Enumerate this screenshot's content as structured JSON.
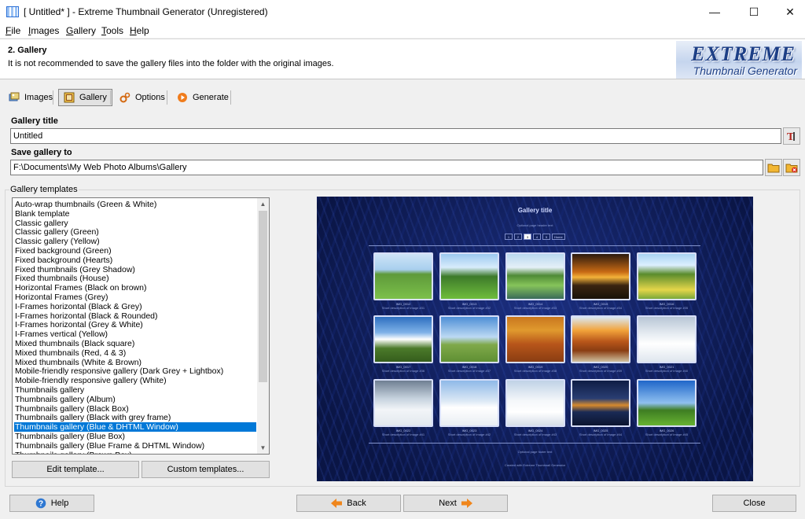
{
  "window": {
    "title": "[ Untitled* ] - Extreme Thumbnail Generator (Unregistered)",
    "controls": {
      "minimize": "—",
      "maximize": "☐",
      "close": "✕"
    }
  },
  "menu": [
    {
      "underline": "F",
      "rest": "ile"
    },
    {
      "underline": "I",
      "rest": "mages"
    },
    {
      "underline": "G",
      "rest": "allery"
    },
    {
      "underline": "T",
      "rest": "ools"
    },
    {
      "underline": "H",
      "rest": "elp"
    }
  ],
  "banner": {
    "title": "2. Gallery",
    "description": "It is not recommended to save the gallery files into the folder with the original images.",
    "logo_line1": "EXTREME",
    "logo_line2": "Thumbnail Generator"
  },
  "tabs": [
    {
      "label": "Images",
      "icon": "images-icon"
    },
    {
      "label": "Gallery",
      "icon": "gallery-icon",
      "active": true
    },
    {
      "label": "Options",
      "icon": "options-gear-icon"
    },
    {
      "label": "Generate",
      "icon": "generate-play-icon"
    }
  ],
  "form": {
    "gallery_title_label": "Gallery title",
    "gallery_title_value": "Untitled",
    "save_to_label": "Save gallery to",
    "save_to_value": "F:\\Documents\\My Web Photo Albums\\Gallery"
  },
  "templates": {
    "group_label": "Gallery templates",
    "items": [
      "Auto-wrap thumbnails (Green & White)",
      "Blank template",
      "Classic gallery",
      "Classic gallery (Green)",
      "Classic gallery (Yellow)",
      "Fixed background (Green)",
      "Fixed background (Hearts)",
      "Fixed thumbnails (Grey Shadow)",
      "Fixed thumbnails (House)",
      "Horizontal Frames (Black on brown)",
      "Horizontal Frames (Grey)",
      "I-Frames horizontal (Black & Grey)",
      "I-Frames horizontal (Black & Rounded)",
      "I-Frames horizontal (Grey & White)",
      "I-Frames vertical (Yellow)",
      "Mixed thumbnails (Black square)",
      "Mixed thumbnails (Red, 4 & 3)",
      "Mixed thumbnails (White & Brown)",
      "Mobile-friendly responsive gallery (Dark Grey + Lightbox)",
      "Mobile-friendly responsive gallery (White)",
      "Thumbnails gallery",
      "Thumbnails gallery (Album)",
      "Thumbnails gallery (Black Box)",
      "Thumbnails gallery (Black with grey frame)",
      "Thumbnails gallery (Blue & DHTML Window)",
      "Thumbnails gallery (Blue Box)",
      "Thumbnails gallery (Blue Frame & DHTML Window)",
      "Thumbnails gallery (Brown Box)"
    ],
    "selected_index": 24,
    "edit_button": "Edit template...",
    "custom_button": "Custom templates..."
  },
  "preview": {
    "title": "Gallery title",
    "header_text": "Optional page header text",
    "pages": [
      "1",
      "2",
      "3",
      "4",
      "5",
      "Home"
    ],
    "current_page": "3",
    "footer_text": "Optional page footer text",
    "credit_text": "Created with Extreme Thumbnail Generator",
    "thumbs": [
      {
        "name": "IMG_0012",
        "desc": "Short description of image #31"
      },
      {
        "name": "IMG_0013",
        "desc": "Short description of image #32"
      },
      {
        "name": "IMG_0014",
        "desc": "Short description of image #33"
      },
      {
        "name": "IMG_0015",
        "desc": "Short description of image #34"
      },
      {
        "name": "IMG_0016",
        "desc": "Short description of image #35"
      },
      {
        "name": "IMG_0017",
        "desc": "Short description of image #36"
      },
      {
        "name": "IMG_0018",
        "desc": "Short description of image #37"
      },
      {
        "name": "IMG_0019",
        "desc": "Short description of image #38"
      },
      {
        "name": "IMG_0020",
        "desc": "Short description of image #39"
      },
      {
        "name": "IMG_0021",
        "desc": "Short description of image #40"
      },
      {
        "name": "IMG_0022",
        "desc": "Short description of image #41"
      },
      {
        "name": "IMG_0023",
        "desc": "Short description of image #42"
      },
      {
        "name": "IMG_0024",
        "desc": "Short description of image #43"
      },
      {
        "name": "IMG_0025",
        "desc": "Short description of image #44"
      },
      {
        "name": "IMG_0026",
        "desc": "Short description of image #45"
      }
    ]
  },
  "footer": {
    "help": "Help",
    "back": "Back",
    "next": "Next",
    "close": "Close"
  },
  "colors": {
    "selection": "#0078d7",
    "gallery_bg": "#0b1a4e",
    "arrow": "#f0861c"
  }
}
